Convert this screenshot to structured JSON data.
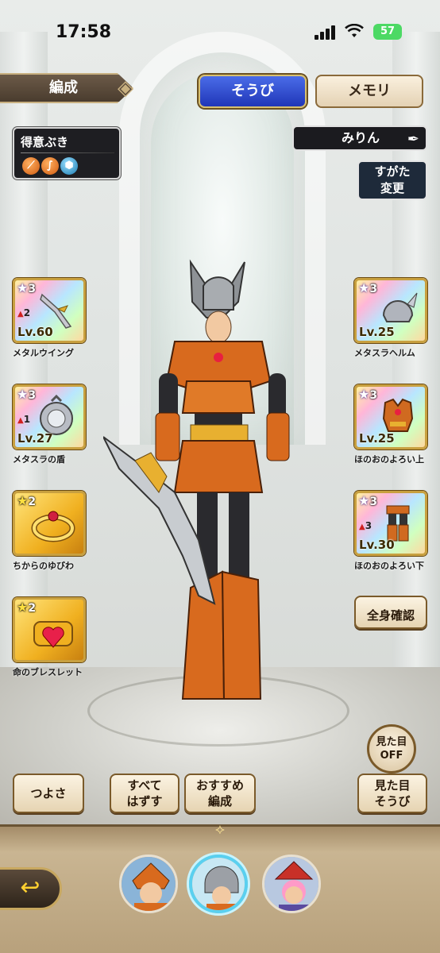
{
  "status_bar": {
    "time": "17:58",
    "battery": "57"
  },
  "header": {
    "formation_label": "編成",
    "tabs": [
      {
        "label": "そうび",
        "selected": true
      },
      {
        "label": "メモリ",
        "selected": false
      }
    ]
  },
  "favorite_weapons": {
    "title": "得意ぶき",
    "icons": [
      "sword-icon",
      "whip-icon",
      "shield-icon"
    ]
  },
  "character": {
    "name": "みりん",
    "change_look_label_line1": "すがた",
    "change_look_label_line2": "変更"
  },
  "left_slots": [
    {
      "name": "メタルウイング",
      "stars": "3",
      "plus": "2",
      "level": "Lv.60",
      "style": "rainbow"
    },
    {
      "name": "メタスラの盾",
      "stars": "3",
      "plus": "1",
      "level": "Lv.27",
      "style": "rainbow"
    },
    {
      "name": "ちからのゆびわ",
      "stars": "2",
      "level": "",
      "style": "gold"
    },
    {
      "name": "命のブレスレット",
      "stars": "2",
      "level": "",
      "style": "gold"
    }
  ],
  "right_slots": [
    {
      "name": "メタスラヘルム",
      "stars": "3",
      "level": "Lv.25",
      "style": "rainbow"
    },
    {
      "name": "ほのおのよろい上",
      "stars": "3",
      "level": "Lv.25",
      "style": "rainbow"
    },
    {
      "name": "ほのおのよろい下",
      "stars": "3",
      "plus": "3",
      "level": "Lv.30",
      "style": "rainbow"
    }
  ],
  "buttons": {
    "full_body_check": "全身確認",
    "appearance_off_line1": "見た目",
    "appearance_off_line2": "OFF",
    "strength": "つよさ",
    "remove_all_line1": "すべて",
    "remove_all_line2": "はずす",
    "recommended_line1": "おすすめ",
    "recommended_line2": "編成",
    "appearance_equip_line1": "見た目",
    "appearance_equip_line2": "そうび"
  },
  "party": {
    "members": [
      "member-1",
      "member-2",
      "member-3"
    ],
    "selected_index": 1
  },
  "colors": {
    "tab_selected": "#2036b8",
    "tab_unselected": "#e4d2b4",
    "frame_gold": "#c8a040"
  }
}
